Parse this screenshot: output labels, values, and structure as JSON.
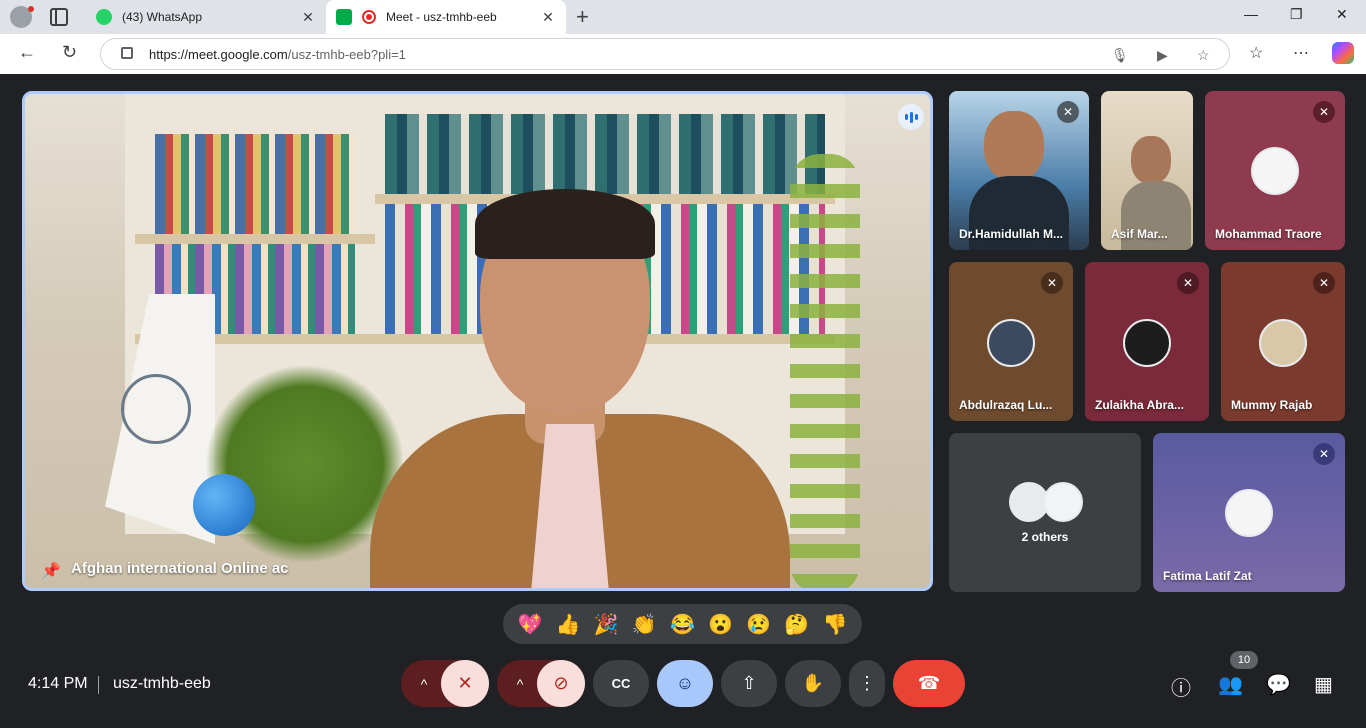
{
  "browser": {
    "tabs": [
      {
        "title": "(43) WhatsApp",
        "favicon": "whatsapp-icon",
        "active": false
      },
      {
        "title": "Meet - usz-tmhb-eeb",
        "favicon": "meet-icon",
        "active": true
      }
    ],
    "url_host": "https://meet.google.com",
    "url_path": "/usz-tmhb-eeb?pli=1"
  },
  "main_video": {
    "participant_name": "Afghan international Online ac"
  },
  "tiles": [
    {
      "name": "Dr.Hamidullah M...",
      "muted": true,
      "background": "#4a7da8"
    },
    {
      "name": "Asif Mar...",
      "muted": false,
      "background": "#c9b99c"
    },
    {
      "name": "Mohammad Traore",
      "muted": true,
      "background": "#8e3a4f"
    },
    {
      "name": "Abdulrazaq Lu...",
      "muted": true,
      "background": "#6e4a2e"
    },
    {
      "name": "Zulaikha Abra...",
      "muted": true,
      "background": "#7a2a3a"
    },
    {
      "name": "Mummy Rajab",
      "muted": true,
      "background": "#7a3a2e"
    },
    {
      "name": "2 others",
      "muted": false,
      "background": "#3c4043"
    },
    {
      "name": "Fatima Latif Zat",
      "muted": true,
      "background": "#6a6aa8"
    }
  ],
  "reactions": [
    "💖",
    "👍",
    "🎉",
    "👏",
    "😂",
    "😮",
    "😢",
    "🤔",
    "👎"
  ],
  "bottom": {
    "time": "4:14 PM",
    "separator": "|",
    "meeting_code": "usz-tmhb-eeb",
    "participant_count": "10"
  },
  "icons": {
    "chevron_up": "^",
    "mic_off": "✕",
    "cam_off": "⊘",
    "cc": "CC",
    "emoji": "☺",
    "present": "⇧",
    "hand": "✋",
    "more": "⋮",
    "hangup": "☎",
    "info": "ⓘ",
    "people": "👥",
    "chat": "💬",
    "apps": "▦",
    "pin": "📌"
  },
  "colors": {
    "accent": "#1a73e8",
    "danger": "#ea4335",
    "muted_red": "#5c1e1e",
    "tile_bg": "#3c4043"
  }
}
